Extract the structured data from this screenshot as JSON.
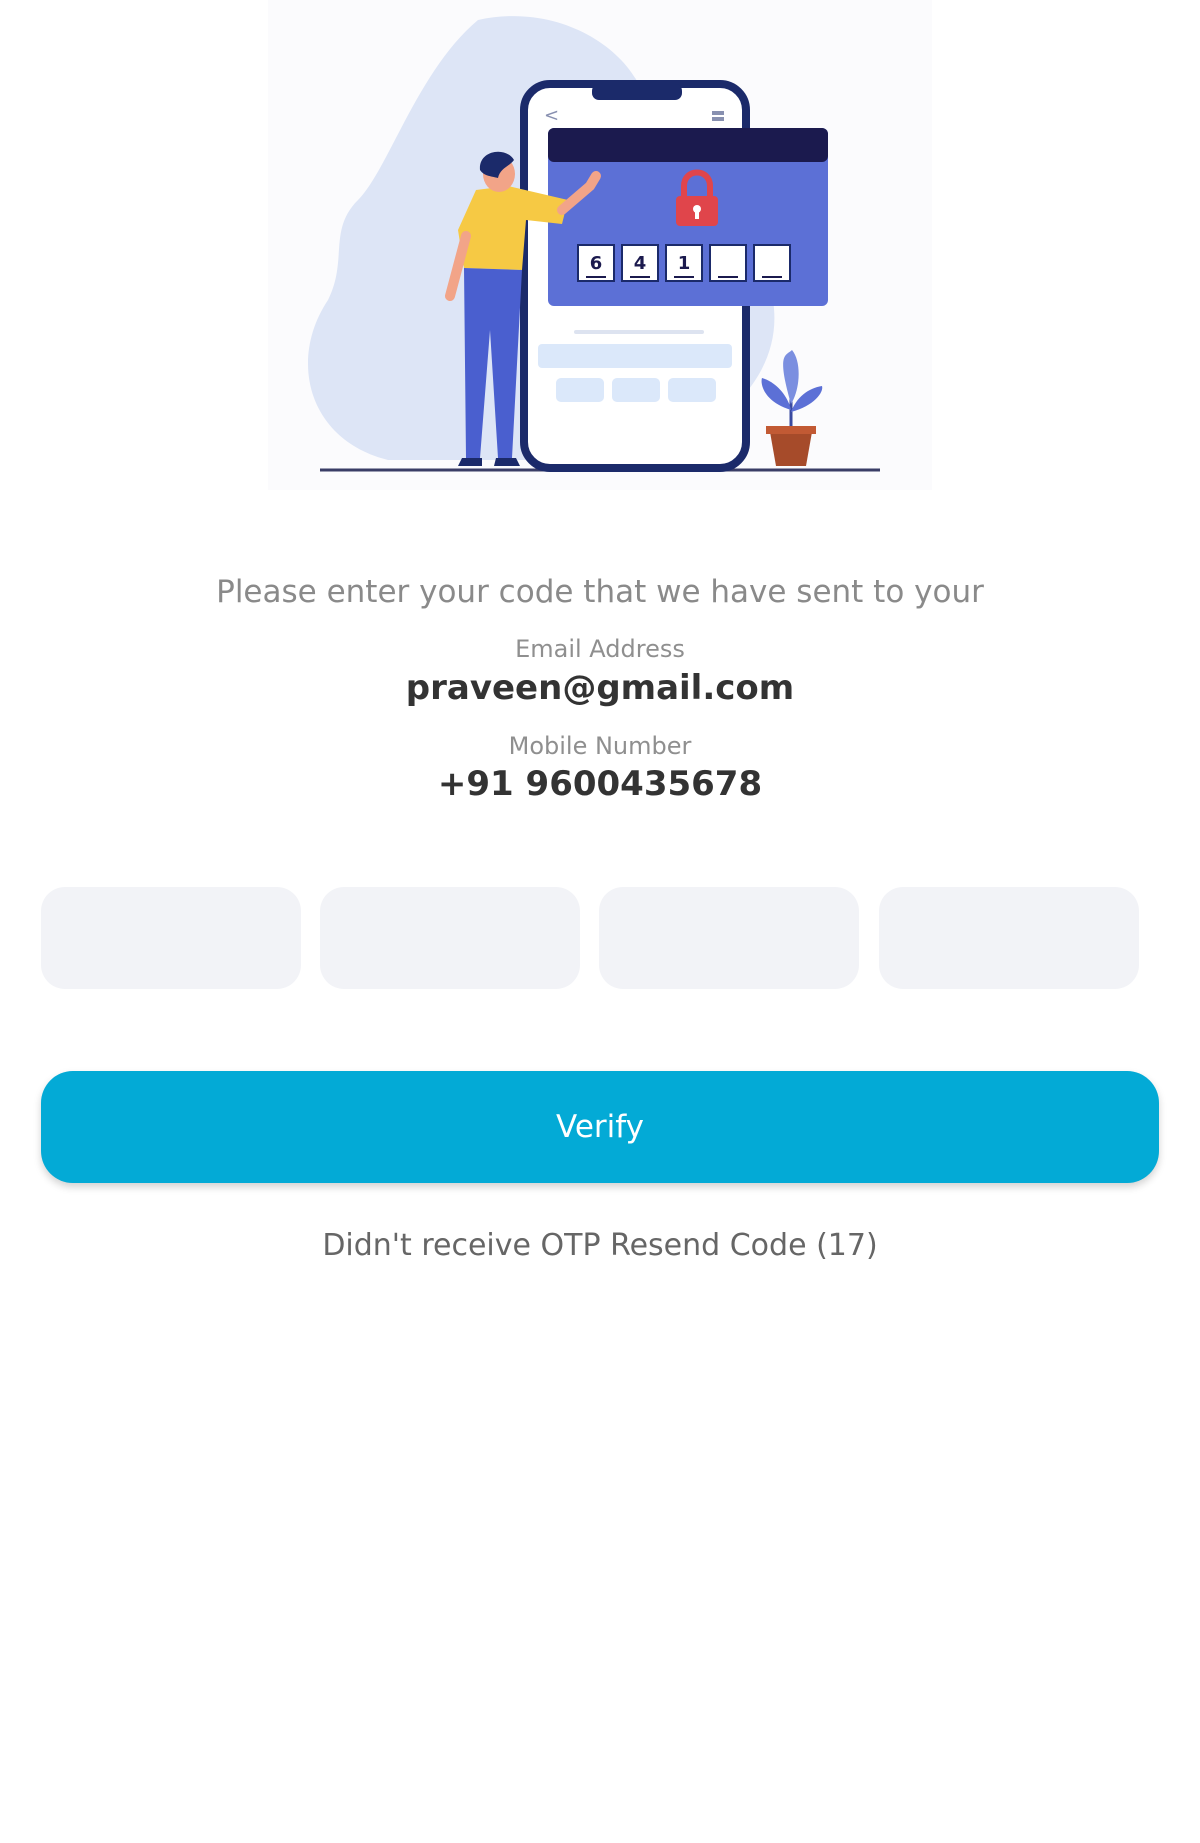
{
  "intro": {
    "text": "Please enter your code that we have sent to your"
  },
  "email": {
    "label": "Email Address",
    "value": "praveen@gmail.com"
  },
  "mobile": {
    "label": "Mobile Number",
    "value": "+91 9600435678"
  },
  "otp": {
    "boxes": [
      "",
      "",
      "",
      ""
    ]
  },
  "illustration": {
    "code_digits": [
      "6",
      "4",
      "1",
      "",
      ""
    ],
    "back_glyph": "<"
  },
  "verify": {
    "label": "Verify"
  },
  "resend": {
    "prefix": "Didn't receive OTP",
    "link": "Resend Code",
    "timer": "(17)"
  },
  "colors": {
    "primary": "#03aad6",
    "otp_box_bg": "#f2f3f7",
    "illustration_blue": "#5c70d6",
    "illustration_dark": "#1b1a4e",
    "lock_red": "#e0454b",
    "shirt_yellow": "#f6c944"
  }
}
